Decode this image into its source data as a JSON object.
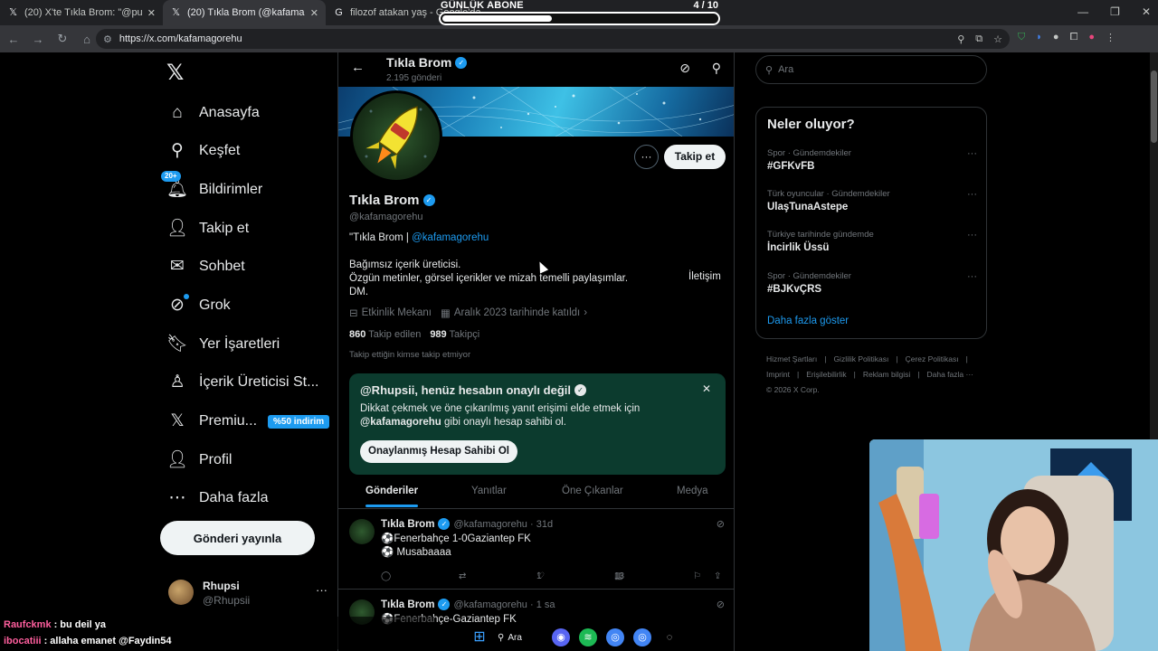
{
  "browser": {
    "tabs": [
      {
        "title": "(20) X'te Tıkla Brom: \"@pusholo",
        "icon": "x-icon"
      },
      {
        "title": "(20) Tıkla Brom (@kafamagorehu",
        "icon": "x-icon"
      },
      {
        "title": "filozof atakan yaş - Google'da A",
        "icon": "google-icon"
      }
    ],
    "url": "https://x.com/kafamagorehu"
  },
  "overlay": {
    "label": "GÜNLÜK ABONE",
    "count": "4 / 10",
    "progress": 0.4
  },
  "sidebar": {
    "items": [
      {
        "label": "Anasayfa",
        "icon": "home-icon",
        "glyph": "⌂"
      },
      {
        "label": "Keşfet",
        "icon": "search-icon",
        "glyph": "⚲"
      },
      {
        "label": "Bildirimler",
        "icon": "bell-icon",
        "glyph": "🔔︎",
        "badge": "20+"
      },
      {
        "label": "Takip et",
        "icon": "add-user-icon",
        "glyph": "👤︎"
      },
      {
        "label": "Sohbet",
        "icon": "mail-icon",
        "glyph": "✉"
      },
      {
        "label": "Grok",
        "icon": "grok-icon",
        "glyph": "⊘"
      },
      {
        "label": "Yer İşaretleri",
        "icon": "bookmark-icon",
        "glyph": "🔖︎"
      },
      {
        "label": "İçerik Üreticisi St...",
        "icon": "creator-icon",
        "glyph": "♙"
      },
      {
        "label": "Premiu...",
        "icon": "x-premium-icon",
        "glyph": "𝕏",
        "badge": "%50 indirim"
      },
      {
        "label": "Profil",
        "icon": "profile-icon",
        "glyph": "👤︎"
      },
      {
        "label": "Daha fazla",
        "icon": "more-circle-icon",
        "glyph": "⋯"
      }
    ],
    "post_button": "Gönderi yayınla",
    "account": {
      "name": "Rhupsi",
      "handle": "@Rhupsii"
    }
  },
  "profile": {
    "header_name": "Tıkla Brom",
    "post_count": "2.195 gönderi",
    "name": "Tıkla Brom",
    "handle": "@kafamagorehu",
    "follow_label": "Takip et",
    "bio_line1_prefix": "\"Tıkla Brom | ",
    "bio_link": "@kafamagorehu",
    "bio_line2": "Bağımsız içerik üreticisi.",
    "bio_line3": "Özgün metinler, görsel içerikler ve mizah temelli paylaşımlar.",
    "bio_contact": "İletişim",
    "bio_line4": "DM.",
    "location": "Etkinlik Mekanı",
    "joined": "Aralık 2023 tarihinde katıldı",
    "following_count": "860",
    "following_label": "Takip edilen",
    "followers_count": "989",
    "followers_label": "Takipçi",
    "known_by": "Takip ettiğin kimse takip etmiyor"
  },
  "verify_card": {
    "title": "@Rhupsii, henüz hesabın onaylı değil",
    "desc_line1": "Dikkat çekmek ve öne çıkarılmış yanıt erişimi elde etmek için",
    "desc_handle": "@kafamagorehu",
    "desc_line2_rest": " gibi onaylı hesap sahibi ol.",
    "button": "Onaylanmış Hesap Sahibi Ol"
  },
  "profile_tabs": [
    "Gönderiler",
    "Yanıtlar",
    "Öne Çıkanlar",
    "Medya"
  ],
  "tweets": [
    {
      "name": "Tıkla Brom",
      "handle_time": "@kafamagorehu · 31d",
      "line1": "⚽Fenerbahçe 1-0Gaziantep FK",
      "line2": "⚽  Musabaaaa",
      "replies": "",
      "retweets": "",
      "likes": "1",
      "views": "13"
    },
    {
      "name": "Tıkla Brom",
      "handle_time": "@kafamagorehu · 1 sa",
      "line1": "⚽Fenerbahçe-Gaziantep FK",
      "line2": ""
    }
  ],
  "right": {
    "search_placeholder": "Ara",
    "trends_title": "Neler oluyor?",
    "trends": [
      {
        "context": "Spor · Gündemdekiler",
        "name": "#GFKvFB"
      },
      {
        "context": "Türk oyuncular · Gündemdekiler",
        "name": "UlaşTunaAstepe"
      },
      {
        "context": "Türkiye tarihinde gündemde",
        "name": "İncirlik Üssü"
      },
      {
        "context": "Spor · Gündemdekiler",
        "name": "#BJKvÇRS"
      }
    ],
    "show_more": "Daha fazla göster",
    "footer": [
      "Hizmet Şartları",
      "|",
      "Gizlilik Politikası",
      "|",
      "Çerez Politikası",
      "|",
      "Imprint",
      "|",
      "Erişilebilirlik",
      "|",
      "Reklam bilgisi",
      "|",
      "Daha fazla ···",
      "© 2026 X Corp."
    ]
  },
  "chat": [
    {
      "user": "Raufckmk",
      "message": ": bu deil ya"
    },
    {
      "user": "ibocatiii",
      "message": ": allaha emanet @Faydin54"
    }
  ],
  "taskbar": {
    "search_label": "Ara"
  },
  "colors": {
    "accent": "#1d9bf0",
    "verify_card": "#0c3b2e",
    "background": "#000000"
  }
}
